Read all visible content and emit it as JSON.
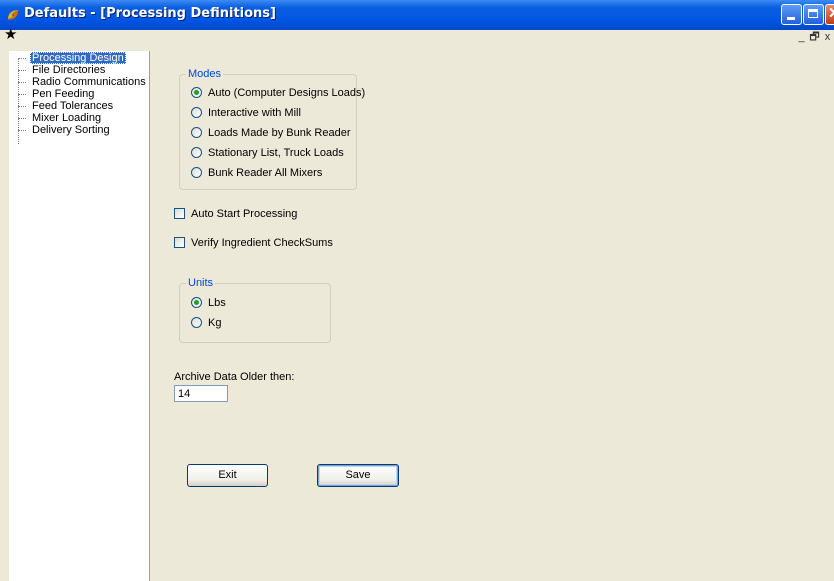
{
  "window": {
    "title": "Defaults - [Processing Definitions]"
  },
  "icons": {
    "app": "app-swirl-icon",
    "pin": "star-pin-icon",
    "minimize": "minimize-icon",
    "maximize": "maximize-icon",
    "close": "close-icon"
  },
  "mdi": {
    "minimize": "_",
    "restore": "🗗",
    "close": "x"
  },
  "tree": {
    "items": [
      {
        "label": "Processing Design",
        "selected": true
      },
      {
        "label": "File Directories"
      },
      {
        "label": "Radio Communications"
      },
      {
        "label": "Pen Feeding"
      },
      {
        "label": "Feed Tolerances"
      },
      {
        "label": "Mixer Loading"
      },
      {
        "label": "Delivery Sorting"
      }
    ]
  },
  "modes": {
    "title": "Modes",
    "options": [
      {
        "label": "Auto (Computer Designs Loads)",
        "selected": true
      },
      {
        "label": "Interactive with Mill"
      },
      {
        "label": "Loads Made by Bunk Reader"
      },
      {
        "label": "Stationary List, Truck Loads"
      },
      {
        "label": "Bunk Reader All Mixers"
      }
    ]
  },
  "auto_start": {
    "label": "Auto Start Processing",
    "checked": false
  },
  "verify": {
    "label": "Verify Ingredient CheckSums",
    "checked": false
  },
  "units": {
    "title": "Units",
    "options": [
      {
        "label": "Lbs",
        "selected": true
      },
      {
        "label": "Kg"
      }
    ]
  },
  "archive": {
    "label": "Archive Data Older then:",
    "value": "14"
  },
  "buttons": {
    "exit": "Exit",
    "save": "Save"
  },
  "colors": {
    "titlebar": "#0054e3",
    "window_bg": "#ece9d8",
    "group_title": "#0046d5",
    "selection": "#316ac5"
  }
}
